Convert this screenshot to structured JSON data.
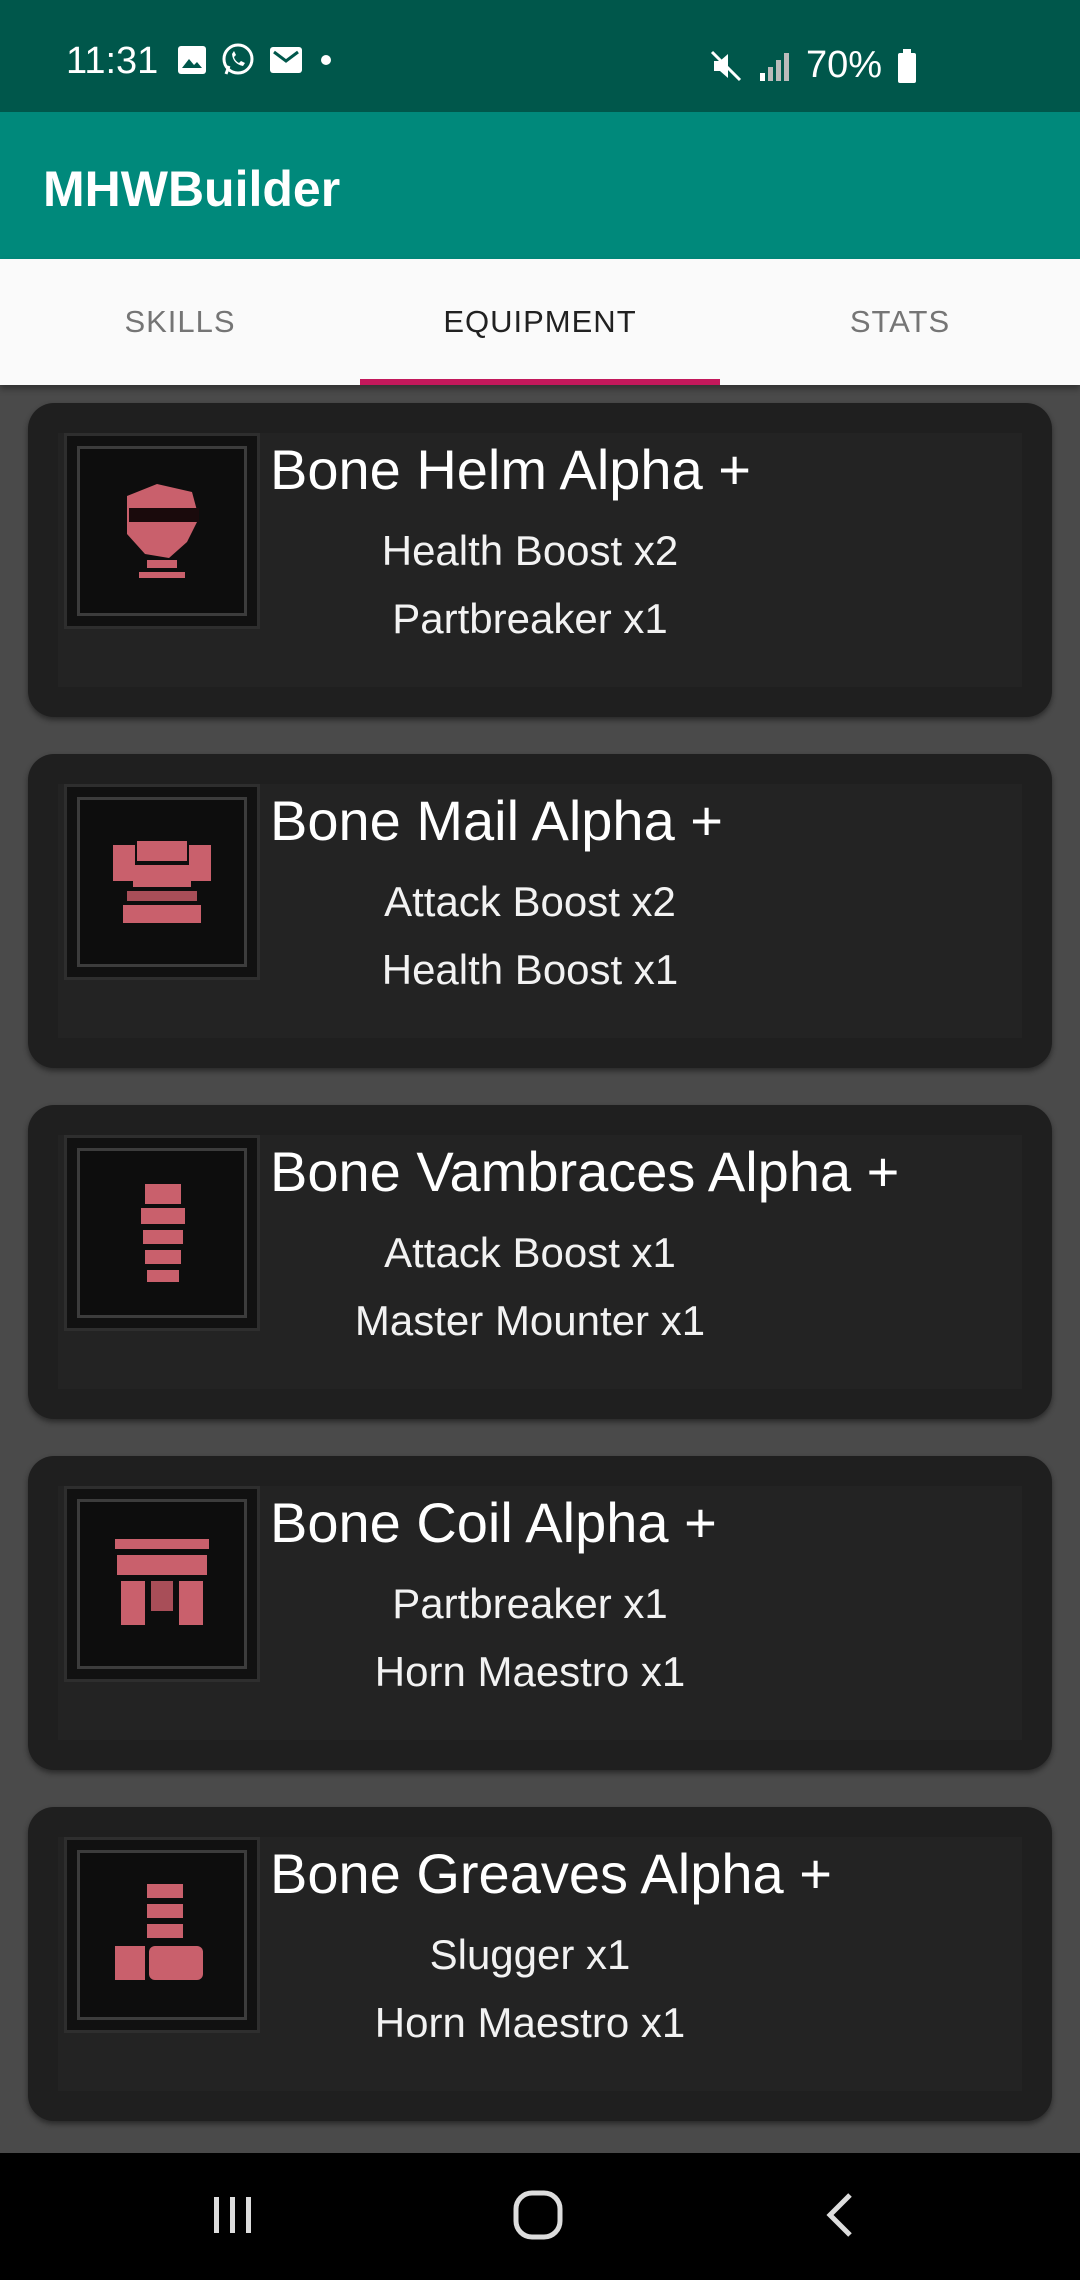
{
  "status": {
    "time": "11:31",
    "battery": "70%",
    "icons_left": [
      "gallery-icon",
      "whatsapp-icon",
      "mail-icon",
      "dot-icon"
    ],
    "icons_right": [
      "mute-icon",
      "signal-icon",
      "battery-icon"
    ]
  },
  "app": {
    "title": "MHWBuilder"
  },
  "tabs": [
    {
      "label": "SKILLS",
      "selected": false
    },
    {
      "label": "EQUIPMENT",
      "selected": true
    },
    {
      "label": "STATS",
      "selected": false
    }
  ],
  "equipment": [
    {
      "name": "Bone Helm Alpha +",
      "icon": "helm-icon",
      "skills": [
        "Health Boost x2",
        "Partbreaker x1"
      ]
    },
    {
      "name": "Bone Mail Alpha +",
      "icon": "chest-armor-icon",
      "skills": [
        "Attack Boost x2",
        "Health Boost x1"
      ]
    },
    {
      "name": "Bone Vambraces Alpha +",
      "icon": "gauntlet-icon",
      "skills": [
        "Attack Boost x1",
        "Master Mounter x1"
      ]
    },
    {
      "name": "Bone Coil Alpha +",
      "icon": "waist-armor-icon",
      "skills": [
        "Partbreaker x1",
        "Horn Maestro x1"
      ]
    },
    {
      "name": "Bone Greaves Alpha +",
      "icon": "greaves-icon",
      "skills": [
        "Slugger x1",
        "Horn Maestro x1"
      ]
    }
  ],
  "colors": {
    "status_bar": "#00574b",
    "app_bar": "#00897b",
    "tab_indicator": "#c2185b",
    "icon_accent": "#d06070"
  },
  "nav": [
    "recents-button",
    "home-button",
    "back-button"
  ]
}
